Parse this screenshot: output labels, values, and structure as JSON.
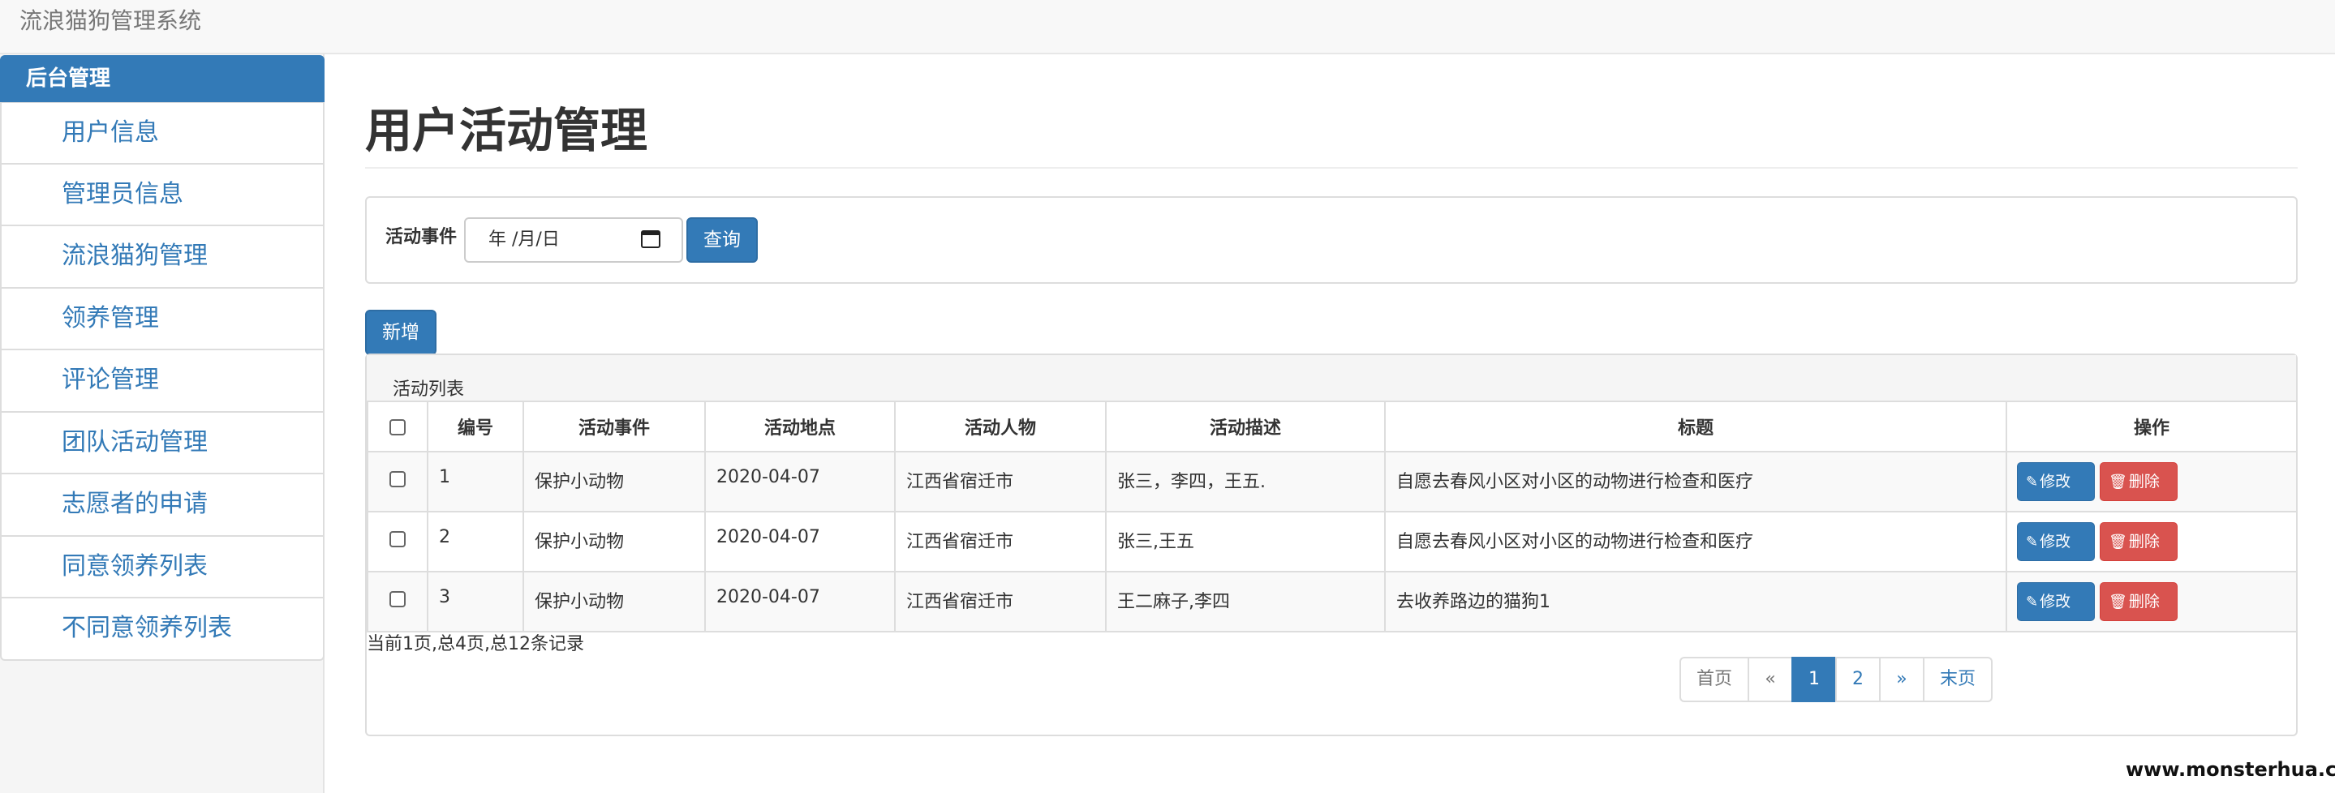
{
  "app": {
    "title": "流浪猫狗管理系统"
  },
  "sidebar": {
    "header": "后台管理",
    "items": [
      {
        "label": "用户信息"
      },
      {
        "label": "管理员信息"
      },
      {
        "label": "流浪猫狗管理"
      },
      {
        "label": "领养管理"
      },
      {
        "label": "评论管理"
      },
      {
        "label": "团队活动管理"
      },
      {
        "label": "志愿者的申请"
      },
      {
        "label": "同意领养列表"
      },
      {
        "label": "不同意领养列表"
      }
    ]
  },
  "page": {
    "title": "用户活动管理"
  },
  "search": {
    "label": "活动事件",
    "date_placeholder": "年 /月/日",
    "query_label": "查询"
  },
  "toolbar": {
    "add_label": "新增"
  },
  "table": {
    "caption": "活动列表",
    "columns": [
      "编号",
      "活动事件",
      "活动地点",
      "活动人物",
      "活动描述",
      "标题",
      "操作"
    ],
    "rows": [
      {
        "id": "1",
        "event": "保护小动物",
        "date": "2020-04-07",
        "place": "江西省宿迁市",
        "people": "张三，李四，王五.",
        "title": "自愿去春风小区对小区的动物进行检查和医疗"
      },
      {
        "id": "2",
        "event": "保护小动物",
        "date": "2020-04-07",
        "place": "江西省宿迁市",
        "people": "张三,王五",
        "title": "自愿去春风小区对小区的动物进行检查和医疗"
      },
      {
        "id": "3",
        "event": "保护小动物",
        "date": "2020-04-07",
        "place": "江西省宿迁市",
        "people": "王二麻子,李四",
        "title": "去收养路边的猫狗1"
      }
    ],
    "edit_label": "修改",
    "delete_label": "删除"
  },
  "pagination": {
    "summary": "当前1页,总4页,总12条记录",
    "first": "首页",
    "prev": "«",
    "pages": [
      "1",
      "2"
    ],
    "current": "1",
    "next": "»",
    "last": "末页"
  },
  "watermark": "www.monsterhua.com",
  "colors": {
    "primary": "#337ab7",
    "danger": "#d9534f",
    "navbar": "#f8f8f8"
  },
  "icons": {
    "date": "calendar-icon",
    "edit": "pencil-icon",
    "delete": "trash-icon"
  }
}
